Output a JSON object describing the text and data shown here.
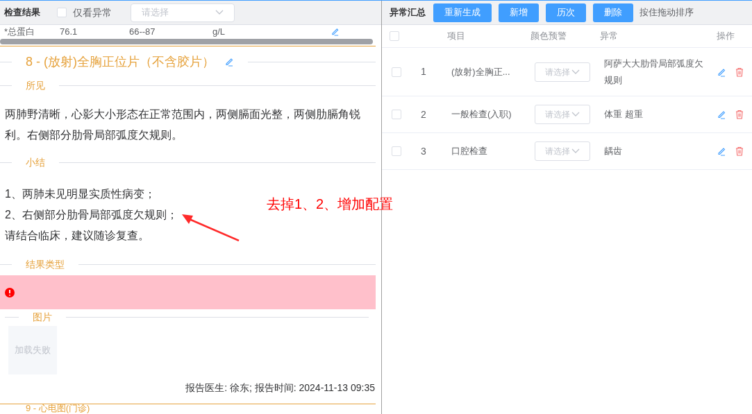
{
  "left_panel": {
    "title": "检查结果",
    "only_abnormal": {
      "label": "仅看异常",
      "checked": false
    },
    "filter_select": {
      "placeholder": "请选择"
    },
    "lab_row": {
      "item": "*总蛋白",
      "value": "76.1",
      "range": "66--87",
      "unit": "g/L"
    },
    "exam": {
      "title": "8 - (放射)全胸正位片（不含胶片）",
      "findings_label": "所见",
      "findings": "两肺野清晰，心影大小形态在正常范围内，两侧膈面光整，两侧肋膈角锐利。右侧部分肋骨局部弧度欠规则。",
      "summary_label": "小结",
      "summary_lines": [
        "1、两肺未见明显实质性病变；",
        "2、右侧部分肋骨局部弧度欠规则；",
        "请结合临床，建议随诊复查。"
      ],
      "result_type_label": "结果类型",
      "result_abnormal": true,
      "images_label": "图片",
      "image_placeholder": "加载失败",
      "report": "报告医生: 徐东; 报告时间: 2024-11-13 09:35"
    },
    "next_exam_title": "9 - 心电图(门诊)"
  },
  "annotation": "去掉1、2、增加配置",
  "right_panel": {
    "title": "异常汇总",
    "buttons": [
      "重新生成",
      "新增",
      "历次",
      "删除"
    ],
    "hint": "按住拖动排序",
    "select_all": {
      "checked": false
    },
    "columns": [
      "项目",
      "颜色预警",
      "异常",
      "操作"
    ],
    "rows": [
      {
        "index": "1",
        "item": "(放射)全胸正...",
        "color_placeholder": "请选择",
        "abnormal": "阿萨大大肋骨局部弧度欠规则",
        "checked": false
      },
      {
        "index": "2",
        "item": "一般检查(入职)",
        "color_placeholder": "请选择",
        "abnormal": "体重 超重",
        "checked": false
      },
      {
        "index": "3",
        "item": "口腔检查",
        "color_placeholder": "请选择",
        "abnormal": "龋齿",
        "checked": false
      }
    ]
  }
}
